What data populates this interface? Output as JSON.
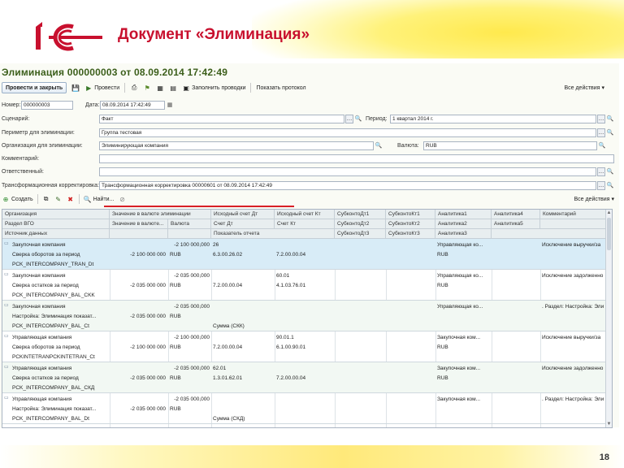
{
  "slide": {
    "title": "Документ «Элиминация»",
    "page_number": "18",
    "logo_text": "1С",
    "colors": {
      "title": "#c8102e",
      "logo": "#c8102e",
      "highlight": "#ffe94d",
      "underline": "#d81f26"
    }
  },
  "window": {
    "title": "Элиминация 000000003 от 08.09.2014 17:42:49",
    "toolbar": {
      "post_and_close": "Провести и закрыть",
      "post": "Провести",
      "fill_entries": "Заполнить проводки",
      "show_protocol": "Показать протокол",
      "all_actions": "Все действия"
    },
    "fields": {
      "number_label": "Номер:",
      "number_value": "000000003",
      "date_label": "Дата:",
      "date_value": "08.09.2014 17:42:49",
      "scenario_label": "Сценарий:",
      "scenario_value": "Факт",
      "period_label": "Период:",
      "period_value": "1 квартал 2014 г.",
      "perimeter_label": "Периметр для элиминации:",
      "perimeter_value": "Группа тестовая",
      "org_label": "Организация для элиминации:",
      "org_value": "Элиминирующая компания",
      "currency_label": "Валюта:",
      "currency_value": "RUB",
      "comment_label": "Комментарий:",
      "comment_value": "",
      "responsible_label": "Ответственный:",
      "responsible_value": "",
      "transform_label": "Трансформационная корректировка:",
      "transform_value": "Трансформационная корректировка 00000601 от 08.09.2014 17:42:49"
    },
    "table_toolbar": {
      "create": "Создать",
      "find": "Найти...",
      "all_actions": "Все действия"
    }
  },
  "grid": {
    "headers": [
      [
        "Организация",
        "Значение в валюте элиминации",
        "Исходный счет Дт",
        "Исходный счет Кт",
        "СубконтоДт1",
        "СубконтоКт1",
        "Аналитика1",
        "Аналитика4",
        "Комментарий"
      ],
      [
        "Раздел ВГО",
        "Значение в валюте...",
        "Валюта",
        "Счет Дт",
        "Счет Кт",
        "СубконтоДт2",
        "СубконтоКт2",
        "Аналитика2",
        "Аналитика5"
      ],
      [
        "Источник данных",
        "",
        "",
        "Показатель отчета",
        "",
        "СубконтоДт3",
        "СубконтоКт3",
        "Аналитика3",
        ""
      ]
    ],
    "rows": [
      {
        "org": "Закупочная компания",
        "section": "Сверка оборотов за период",
        "source": "PCK_INTERCOMPANY_TRAN_Dt",
        "value_elim": "-2 100 000,000",
        "value_cur": "-2 100 000 000",
        "currency": "RUB",
        "src_dt": "26",
        "acc_dt": "6.3.00.26.02",
        "indicator": "",
        "src_kt": "",
        "acc_kt": "7.2.00.00.04",
        "an1": "Управляющая ко...",
        "an2": "RUB",
        "an3": "",
        "comment": "Исключение выручки/за"
      },
      {
        "org": "Закупочная компания",
        "section": "Сверка остатков за период",
        "source": "PCK_INTERCOMPANY_BAL_CKK",
        "value_elim": "-2 035 000,000",
        "value_cur": "-2 035 000 000",
        "currency": "RUB",
        "src_dt": "",
        "acc_dt": "7.2.00.00.04",
        "indicator": "",
        "src_kt": "60.01",
        "acc_kt": "4.1.03.76.01",
        "an1": "Управляющая ко...",
        "an2": "RUB",
        "an3": "",
        "comment": "Исключение задолженно"
      },
      {
        "org": "Закупочная компания",
        "section": "Настройка: Элиминация показат...",
        "source": "PCK_INTERCOMPANY_BAL_Ct",
        "value_elim": "-2 035 000,000",
        "value_cur": "-2 035 000 000",
        "currency": "RUB",
        "src_dt": "",
        "acc_dt": "",
        "indicator": "Сумма (СКК)",
        "src_kt": "",
        "acc_kt": "",
        "an1": "Управляющая ко...",
        "an2": "",
        "an3": "",
        "comment": ". Раздел: Настройка: Эли"
      },
      {
        "org": "Управляющая компания",
        "section": "Сверка оборотов за период",
        "source": "PCKINTETRANPCKINTETRAN_Ct",
        "value_elim": "-2 100 000,000",
        "value_cur": "-2 100 000 000",
        "currency": "RUB",
        "src_dt": "",
        "acc_dt": "7.2.00.00.04",
        "indicator": "",
        "src_kt": "90.01.1",
        "acc_kt": "6.1.00.90.01",
        "an1": "Закупочная ком...",
        "an2": "RUB",
        "an3": "",
        "comment": "Исключение выручки/за"
      },
      {
        "org": "Управляющая компания",
        "section": "Сверка остатков за период",
        "source": "PCK_INTERCOMPANY_BAL_СКД",
        "value_elim": "-2 035 000,000",
        "value_cur": "-2 035 000 000",
        "currency": "RUB",
        "src_dt": "62.01",
        "acc_dt": "1.3.01.62.01",
        "indicator": "",
        "src_kt": "",
        "acc_kt": "7.2.00.00.04",
        "an1": "Закупочная ком...",
        "an2": "RUB",
        "an3": "",
        "comment": "Исключение задолженно"
      },
      {
        "org": "Управляющая компания",
        "section": "Настройка: Элиминация показат...",
        "source": "PCK_INTERCOMPANY_BAL_Dt",
        "value_elim": "-2 035 000,000",
        "value_cur": "-2 035 000 000",
        "currency": "RUB",
        "src_dt": "",
        "acc_dt": "",
        "indicator": "Сумма (СКД)",
        "src_kt": "",
        "acc_kt": "",
        "an1": "Закупочная ком...",
        "an2": "",
        "an3": "",
        "comment": ". Раздел: Настройка: Эли"
      }
    ]
  }
}
